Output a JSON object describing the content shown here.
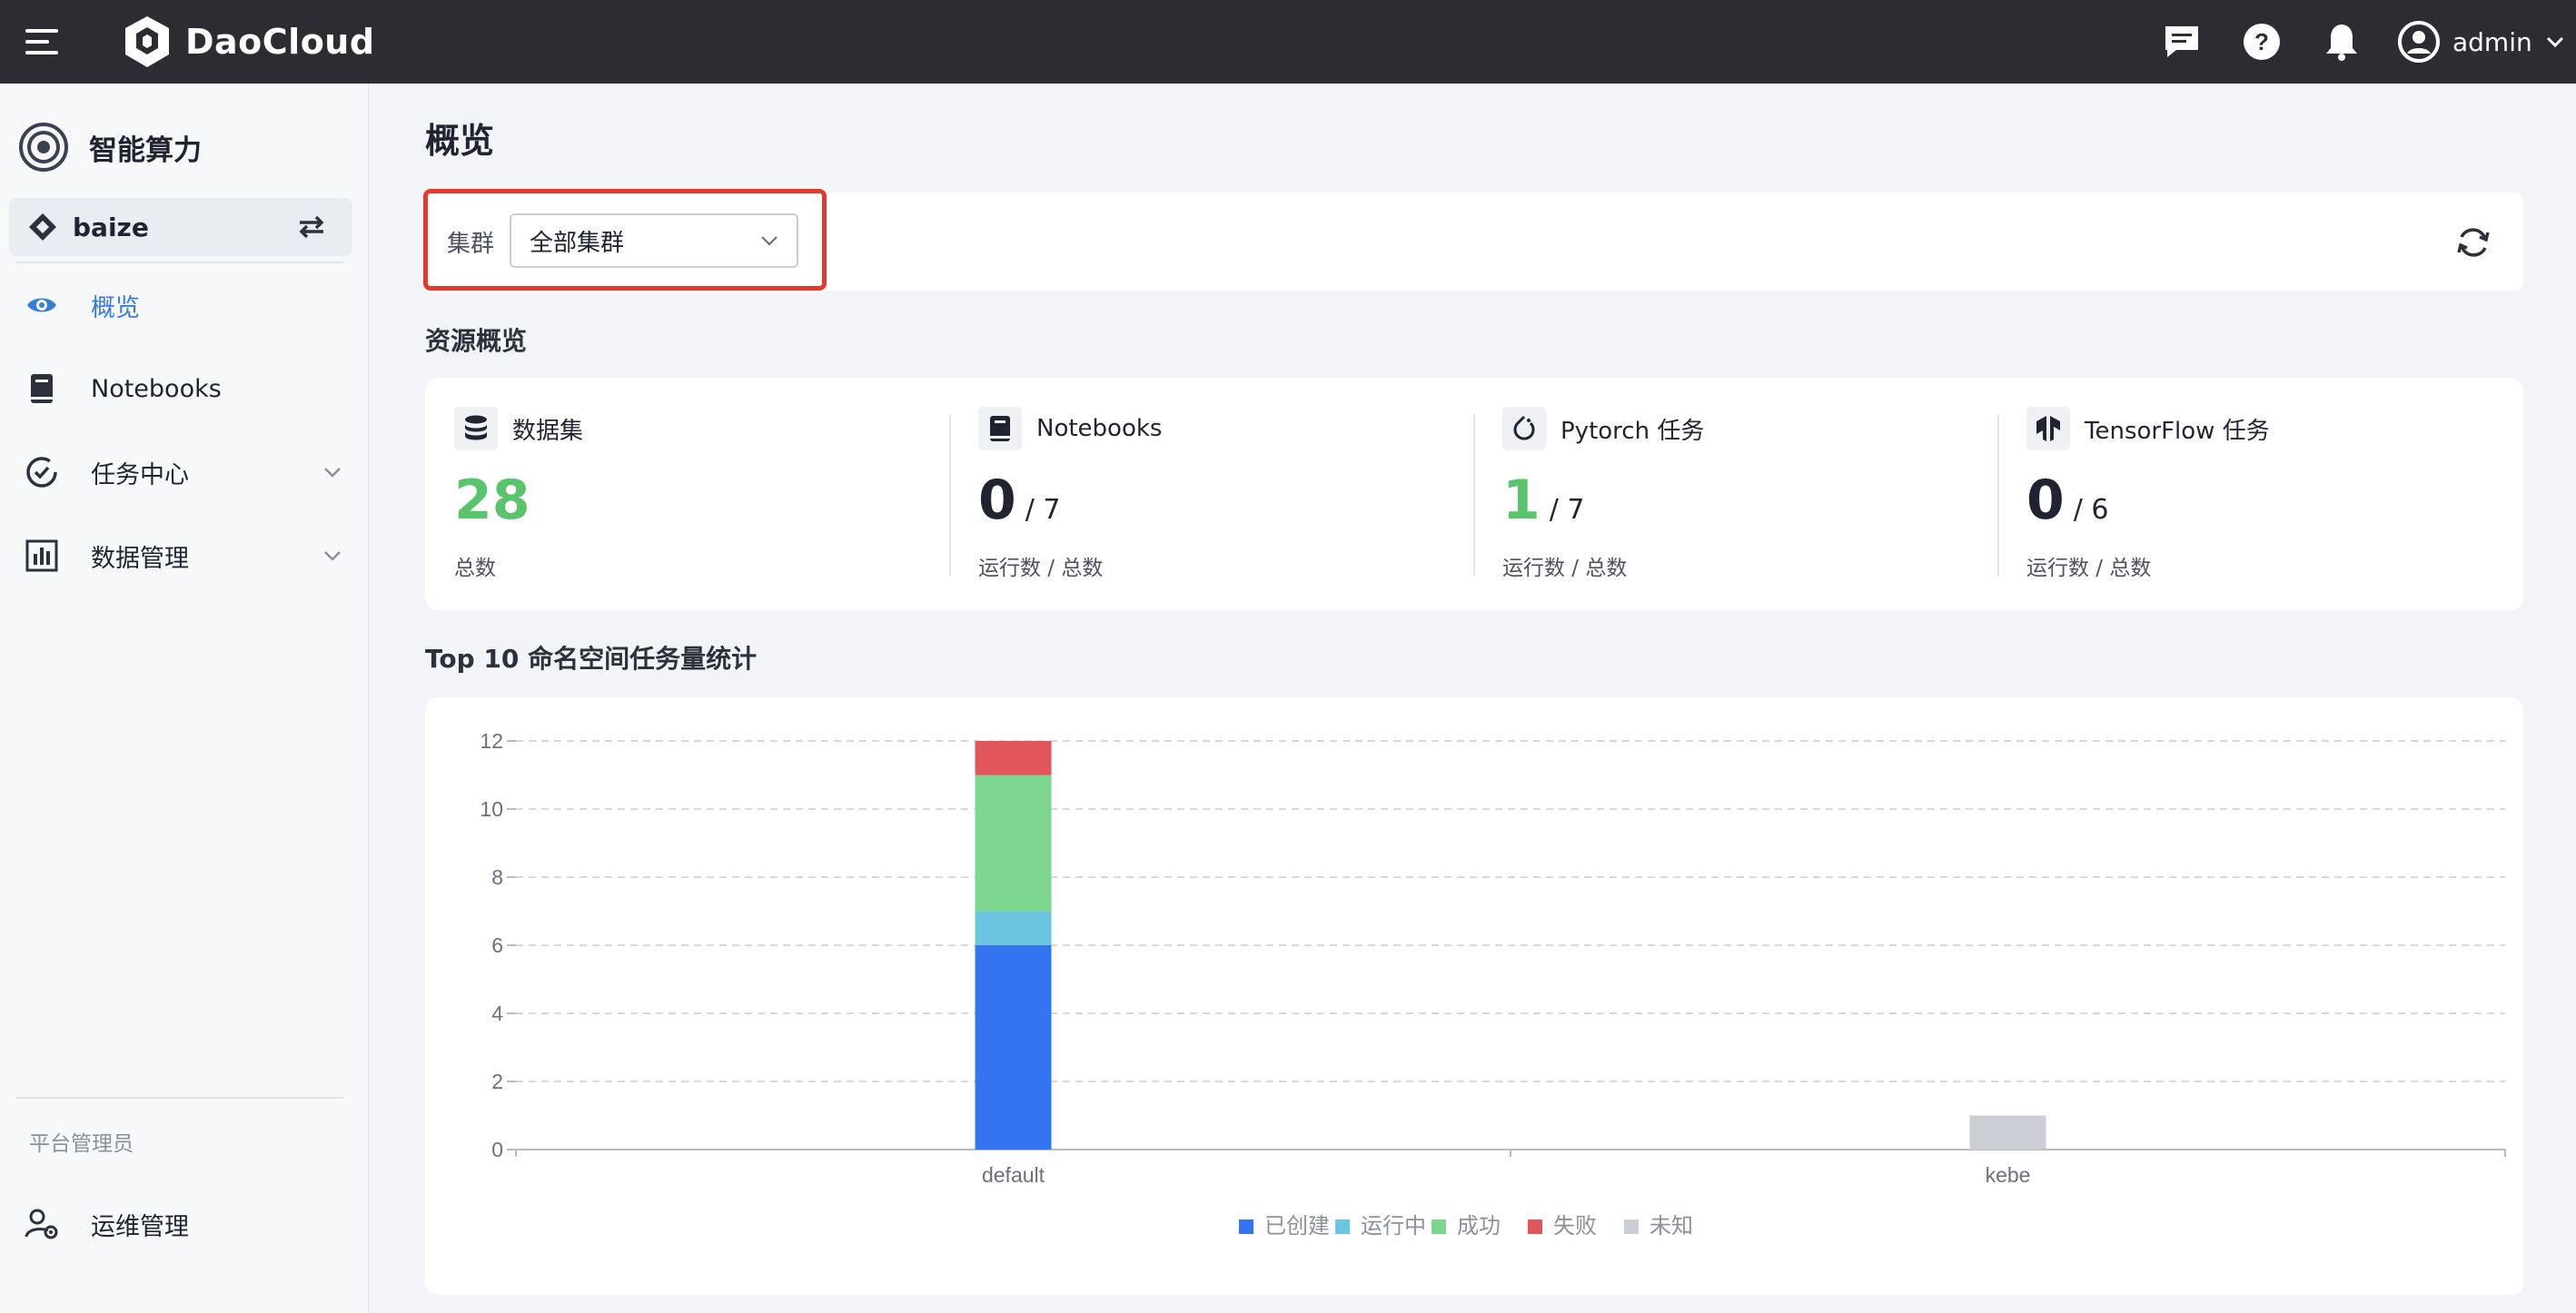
{
  "header": {
    "brand": "DaoCloud",
    "user": "admin",
    "icons": [
      "menu-icon",
      "message-icon",
      "help-icon",
      "bell-icon",
      "user-avatar-icon",
      "chevron-down-icon"
    ]
  },
  "sidebar": {
    "title": "智能算力",
    "workspace": "baize",
    "items": [
      {
        "label": "概览",
        "icon": "eye-icon",
        "active": true
      },
      {
        "label": "Notebooks",
        "icon": "notebook-icon"
      },
      {
        "label": "任务中心",
        "icon": "task-check-icon",
        "expandable": true
      },
      {
        "label": "数据管理",
        "icon": "data-chart-icon",
        "expandable": true
      }
    ],
    "section_label": "平台管理员",
    "admin_item": {
      "label": "运维管理",
      "icon": "user-gear-icon"
    }
  },
  "main": {
    "title": "概览",
    "filter": {
      "label": "集群",
      "value": "全部集群"
    },
    "resources_title": "资源概览",
    "stats": [
      {
        "name": "数据集",
        "icon": "database-icon",
        "value": "28",
        "total": null,
        "sub": "总数",
        "color": "#58c46c"
      },
      {
        "name": "Notebooks",
        "icon": "notebook-icon",
        "value": "0",
        "total": "/ 7",
        "sub": "运行数 / 总数",
        "color": "#1f2430"
      },
      {
        "name": "Pytorch 任务",
        "icon": "pytorch-icon",
        "value": "1",
        "total": "/ 7",
        "sub": "运行数 / 总数",
        "color": "#58c46c"
      },
      {
        "name": "TensorFlow 任务",
        "icon": "tensorflow-icon",
        "value": "0",
        "total": "/ 6",
        "sub": "运行数 / 总数",
        "color": "#1f2430"
      }
    ],
    "chart_title": "Top 10 命名空间任务量统计"
  },
  "chart_data": {
    "type": "bar",
    "stacked": true,
    "categories": [
      "default",
      "kebe"
    ],
    "series": [
      {
        "name": "已创建",
        "color": "#3474f0",
        "values": [
          6,
          0
        ]
      },
      {
        "name": "运行中",
        "color": "#6cc6e0",
        "values": [
          1,
          0
        ]
      },
      {
        "name": "成功",
        "color": "#7dd68f",
        "values": [
          4,
          0
        ]
      },
      {
        "name": "失败",
        "color": "#e0565a",
        "values": [
          1,
          0
        ]
      },
      {
        "name": "未知",
        "color": "#ccced6",
        "values": [
          0,
          1
        ]
      }
    ],
    "ylim": [
      0,
      12
    ],
    "yticks": [
      0,
      2,
      4,
      6,
      8,
      10,
      12
    ],
    "grid": true,
    "legend": "bottom-center"
  }
}
